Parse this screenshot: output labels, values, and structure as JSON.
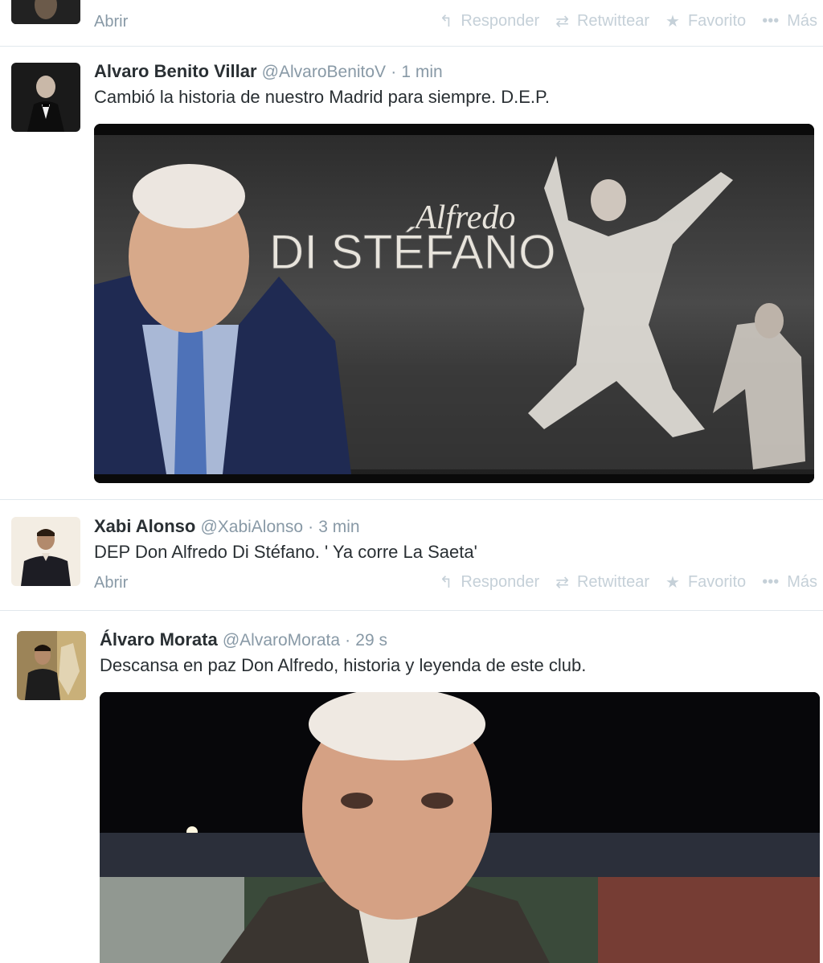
{
  "tweets": [
    {
      "open_label": "Abrir",
      "actions": [
        {
          "icon": "reply-icon",
          "glyph": "↰",
          "label": "Responder"
        },
        {
          "icon": "retweet-icon",
          "glyph": "⇄",
          "label": "Retwittear"
        },
        {
          "icon": "star-icon",
          "glyph": "★",
          "label": "Favorito"
        },
        {
          "icon": "more-icon",
          "glyph": "•••",
          "label": "Más"
        }
      ]
    },
    {
      "fullname": "Alvaro Benito Villar",
      "username": "@AlvaroBenitoV",
      "time": "1 min",
      "text": "Cambió la historia de nuestro Madrid para siempre. D.E.P.",
      "media_title_top": "Alfredo",
      "media_title_main": "DI STÉFANO"
    },
    {
      "fullname": "Xabi Alonso",
      "username": "@XabiAlonso",
      "time": "3 min",
      "text": "DEP Don Alfredo Di Stéfano. ' Ya corre La Saeta'",
      "open_label": "Abrir",
      "actions": [
        {
          "icon": "reply-icon",
          "glyph": "↰",
          "label": "Responder"
        },
        {
          "icon": "retweet-icon",
          "glyph": "⇄",
          "label": "Retwittear"
        },
        {
          "icon": "star-icon",
          "glyph": "★",
          "label": "Favorito"
        },
        {
          "icon": "more-icon",
          "glyph": "•••",
          "label": "Más"
        }
      ]
    },
    {
      "fullname": "Álvaro Morata",
      "username": "@AlvaroMorata",
      "time": "29 s",
      "text": "Descansa en paz Don Alfredo, historia y leyenda de este club."
    }
  ],
  "separator": "·"
}
